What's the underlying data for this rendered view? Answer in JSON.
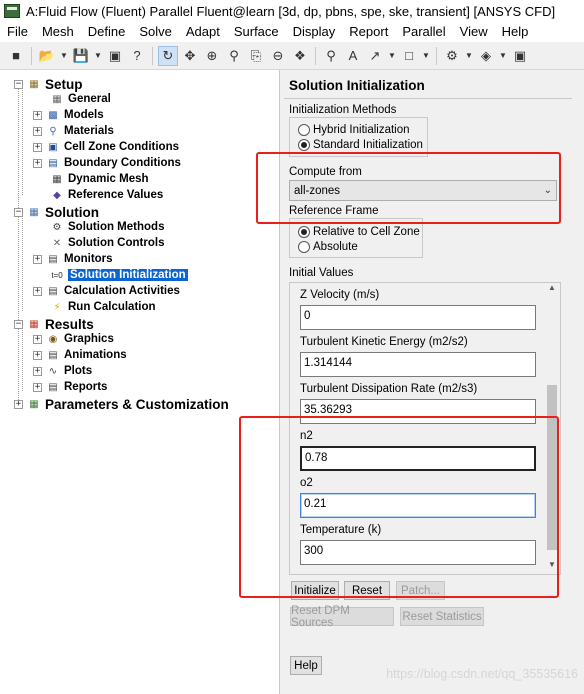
{
  "window": {
    "title": "A:Fluid Flow (Fluent) Parallel Fluent@learn  [3d, dp, pbns, spe, ske, transient] [ANSYS CFD]"
  },
  "menu": [
    "File",
    "Mesh",
    "Define",
    "Solve",
    "Adapt",
    "Surface",
    "Display",
    "Report",
    "Parallel",
    "View",
    "Help"
  ],
  "tree": {
    "setup": "Setup",
    "setup_items": [
      "General",
      "Models",
      "Materials",
      "Cell Zone Conditions",
      "Boundary Conditions",
      "Dynamic Mesh",
      "Reference Values"
    ],
    "solution": "Solution",
    "solution_items": [
      "Solution Methods",
      "Solution Controls",
      "Monitors",
      "Solution Initialization",
      "Calculation Activities",
      "Run Calculation"
    ],
    "results": "Results",
    "results_items": [
      "Graphics",
      "Animations",
      "Plots",
      "Reports"
    ],
    "params": "Parameters & Customization",
    "selected": "Solution Initialization"
  },
  "panel": {
    "title": "Solution Initialization",
    "init_methods_label": "Initialization Methods",
    "hybrid": "Hybrid  Initialization",
    "standard": "Standard Initialization",
    "init_method_selected": "Standard Initialization",
    "compute_from_label": "Compute from",
    "compute_from_value": "all-zones",
    "ref_frame_label": "Reference Frame",
    "rel_cell_zone": "Relative to Cell Zone",
    "absolute": "Absolute",
    "ref_frame_selected": "Relative to Cell Zone",
    "initial_values_label": "Initial Values",
    "fields": [
      {
        "label": "Z Velocity (m/s)",
        "value": "0"
      },
      {
        "label": "Turbulent Kinetic Energy (m2/s2)",
        "value": "1.314144"
      },
      {
        "label": "Turbulent Dissipation Rate (m2/s3)",
        "value": "35.36293"
      },
      {
        "label": "n2",
        "value": "0.78"
      },
      {
        "label": "o2",
        "value": "0.21"
      },
      {
        "label": "Temperature (k)",
        "value": "300"
      }
    ],
    "buttons": {
      "initialize": "Initialize",
      "reset": "Reset",
      "patch": "Patch...",
      "reset_dpm": "Reset DPM Sources",
      "reset_stats": "Reset Statistics",
      "help": "Help"
    }
  },
  "watermark": "https://blog.csdn.net/qq_35535616",
  "colors": {
    "selection": "#0a64d2",
    "annotation_red": "#e8201c"
  }
}
